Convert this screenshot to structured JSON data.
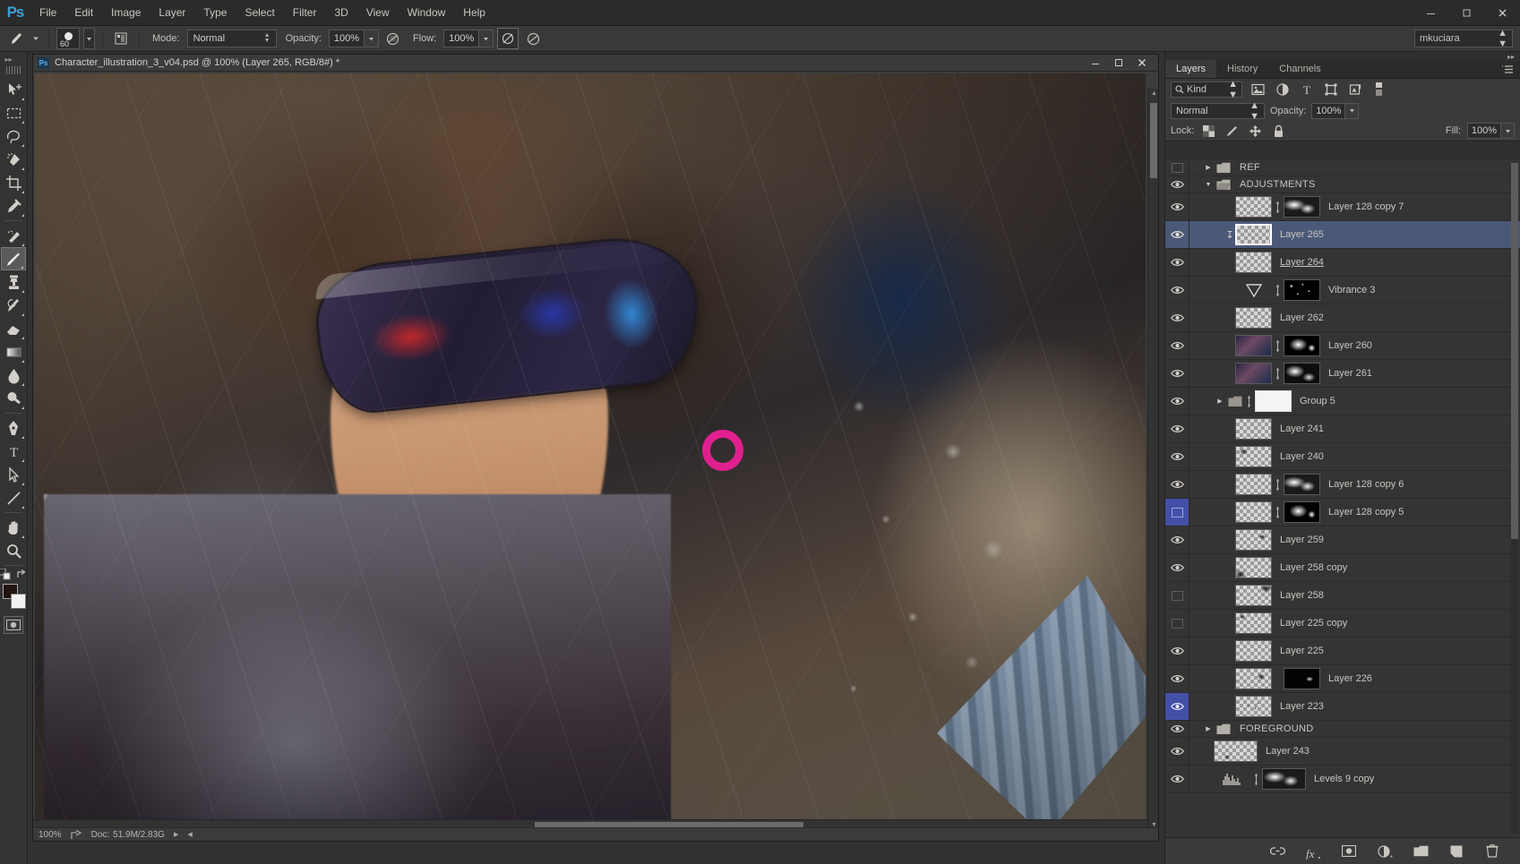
{
  "app": {
    "name": "Ps",
    "logo_text": "Ps"
  },
  "menubar": {
    "items": [
      "File",
      "Edit",
      "Image",
      "Layer",
      "Type",
      "Select",
      "Filter",
      "3D",
      "View",
      "Window",
      "Help"
    ],
    "window_controls": {
      "minimize": "—",
      "maximize": "❐",
      "close": "✕"
    }
  },
  "options_bar": {
    "brush_size": "60",
    "mode_label": "Mode:",
    "mode_value": "Normal",
    "opacity_label": "Opacity:",
    "opacity_value": "100%",
    "flow_label": "Flow:",
    "flow_value": "100%",
    "workspace": "mkuciara",
    "icons": [
      "brush-preset-icon",
      "brush-panel-icon",
      "airbrush-icon",
      "tablet-pressure-opacity-icon",
      "tablet-pressure-size-icon"
    ]
  },
  "toolbar": {
    "tools": [
      {
        "name": "move-tool",
        "glyph": "move"
      },
      {
        "name": "rectangular-marquee-tool",
        "glyph": "marquee"
      },
      {
        "name": "lasso-tool",
        "glyph": "lasso"
      },
      {
        "name": "quick-selection-tool",
        "glyph": "quickselect"
      },
      {
        "name": "crop-tool",
        "glyph": "crop"
      },
      {
        "name": "eyedropper-tool",
        "glyph": "eyedropper"
      },
      {
        "name": "spot-healing-brush-tool",
        "glyph": "heal"
      },
      {
        "name": "brush-tool",
        "glyph": "brush",
        "active": true
      },
      {
        "name": "clone-stamp-tool",
        "glyph": "stamp"
      },
      {
        "name": "history-brush-tool",
        "glyph": "historybrush"
      },
      {
        "name": "eraser-tool",
        "glyph": "eraser"
      },
      {
        "name": "gradient-tool",
        "glyph": "gradient"
      },
      {
        "name": "blur-tool",
        "glyph": "blur"
      },
      {
        "name": "dodge-tool",
        "glyph": "dodge"
      },
      {
        "name": "pen-tool",
        "glyph": "pen"
      },
      {
        "name": "type-tool",
        "glyph": "type"
      },
      {
        "name": "path-selection-tool",
        "glyph": "pathselect"
      },
      {
        "name": "line-tool",
        "glyph": "line"
      },
      {
        "name": "hand-tool",
        "glyph": "hand"
      },
      {
        "name": "zoom-tool",
        "glyph": "zoom"
      }
    ],
    "foreground_color": "#231410",
    "background_color": "#f2f2f2"
  },
  "document": {
    "title": "Character_illustration_3_v04.psd @ 100% (Layer 265, RGB/8#) *",
    "window_controls": {
      "minimize": "—",
      "maximize": "❐",
      "close": "✕"
    },
    "status": {
      "zoom": "100%",
      "doc_label": "Doc:",
      "doc_value": "51.9M/2.83G"
    }
  },
  "panel": {
    "tabs": [
      {
        "label": "Layers",
        "active": true
      },
      {
        "label": "History",
        "active": false
      },
      {
        "label": "Channels",
        "active": false
      }
    ],
    "filter": {
      "kind_label": "Kind",
      "icons": [
        "pixel-filter-icon",
        "adjustment-filter-icon",
        "type-filter-icon",
        "shape-filter-icon",
        "smartobject-filter-icon",
        "filter-toggle-icon"
      ]
    },
    "blend_mode": "Normal",
    "opacity_label": "Opacity:",
    "opacity_value": "100%",
    "lock_label": "Lock:",
    "lock_icons": [
      "lock-transparency-icon",
      "lock-image-icon",
      "lock-position-icon",
      "lock-all-icon"
    ],
    "fill_label": "Fill:",
    "fill_value": "100%",
    "bottom_icons": [
      "link-layers-icon",
      "layer-style-fx-icon",
      "add-layer-mask-icon",
      "new-adjustment-layer-icon",
      "new-group-icon",
      "new-layer-icon",
      "delete-layer-icon"
    ],
    "bottom_fx_label": "fx",
    "layers": [
      {
        "name": "REF",
        "type": "group",
        "visible": false,
        "expanded": false
      },
      {
        "name": "ADJUSTMENTS",
        "type": "group",
        "visible": true,
        "expanded": true
      },
      {
        "name": "Layer 128 copy 7",
        "type": "layer",
        "visible": true,
        "has_mask": true,
        "mask_style": "m1"
      },
      {
        "name": "Layer 265",
        "type": "layer",
        "visible": true,
        "selected": true,
        "clipped": true
      },
      {
        "name": "Layer 264 ",
        "type": "layer",
        "visible": true,
        "renaming": true
      },
      {
        "name": "Vibrance 3",
        "type": "adjustment",
        "visible": true,
        "has_mask": true,
        "mask_style": "m3"
      },
      {
        "name": "Layer 262",
        "type": "layer",
        "visible": true
      },
      {
        "name": "Layer 260",
        "type": "layer",
        "visible": true,
        "image_thumb": true,
        "has_mask": true,
        "mask_style": "m2"
      },
      {
        "name": "Layer 261",
        "type": "layer",
        "visible": true,
        "image_thumb": true,
        "has_mask": true,
        "mask_style": "m4"
      },
      {
        "name": "Group 5",
        "type": "group",
        "visible": true,
        "expanded": false,
        "has_mask": true,
        "mask_style": "white"
      },
      {
        "name": "Layer 241",
        "type": "layer",
        "visible": true
      },
      {
        "name": "Layer 240",
        "type": "layer",
        "visible": true
      },
      {
        "name": "Layer 128 copy 6",
        "type": "layer",
        "visible": true,
        "has_mask": true,
        "mask_style": "m1"
      },
      {
        "name": "Layer 128 copy 5",
        "type": "layer",
        "visible": false,
        "selected_cell": true,
        "has_mask": true,
        "mask_style": "m2"
      },
      {
        "name": "Layer 259",
        "type": "layer",
        "visible": true
      },
      {
        "name": "Layer 258 copy",
        "type": "layer",
        "visible": true
      },
      {
        "name": "Layer 258",
        "type": "layer",
        "visible": false
      },
      {
        "name": "Layer 225 copy",
        "type": "layer",
        "visible": false
      },
      {
        "name": "Layer 225",
        "type": "layer",
        "visible": true
      },
      {
        "name": "Layer 226",
        "type": "layer",
        "visible": true,
        "has_mask": true,
        "mask_style": "m4"
      },
      {
        "name": "Layer 223",
        "type": "layer",
        "visible": true,
        "selected_cell": true
      },
      {
        "name": "FOREGROUND",
        "type": "group",
        "visible": true,
        "expanded": false
      },
      {
        "name": "Layer 243",
        "type": "layer",
        "visible": true
      },
      {
        "name": "Levels 9 copy",
        "type": "levels",
        "visible": true,
        "has_mask": true,
        "mask_style": "m1"
      }
    ]
  },
  "colors": {
    "panel_bg": "#2f2f2f",
    "list_bg": "#343434",
    "selection_blue": "#4b5878",
    "cell_blue": "#4350a8",
    "accent_blue": "#3d9fd6",
    "text": "#c2beb8"
  }
}
